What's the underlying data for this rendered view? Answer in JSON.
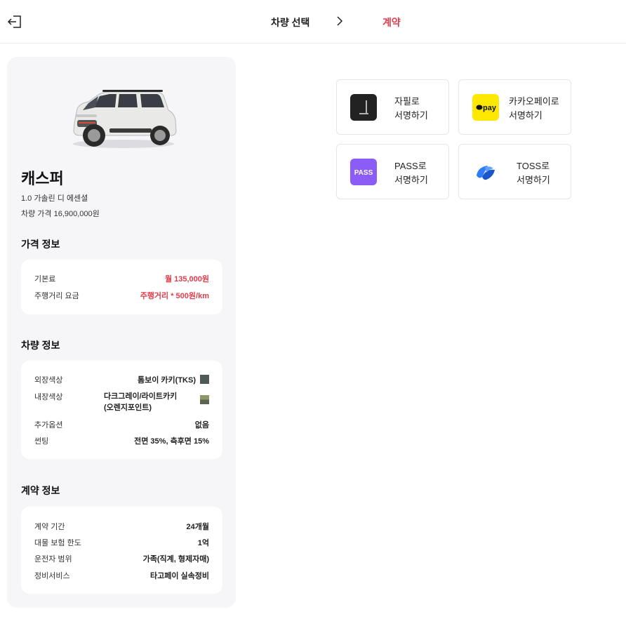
{
  "header": {
    "step1": "차량 선택",
    "step2": "계약"
  },
  "car": {
    "name": "캐스퍼",
    "trim": "1.0 가솔린 디 에센셜",
    "price": "차량 가격 16,900,000원"
  },
  "price_info": {
    "title": "가격 정보",
    "rows": [
      {
        "label": "기본료",
        "value": "월 135,000원"
      },
      {
        "label": "주행거리 요금",
        "value": "주행거리 * 500원/km"
      }
    ]
  },
  "vehicle_info": {
    "title": "차량 정보",
    "exterior_label": "외장색상",
    "exterior_value": "톰보이 카키(TKS)",
    "exterior_color": "#4d5a56",
    "interior_label": "내장색상",
    "interior_value_line1": "다크그레이/라이트카키",
    "interior_value_line2": "(오렌지포인트)",
    "interior_color_top": "#8f9668",
    "interior_color_bottom": "#5d6451",
    "options_label": "추가옵션",
    "options_value": "없음",
    "tint_label": "썬팅",
    "tint_value": "전면 35%, 측후면 15%"
  },
  "contract_info": {
    "title": "계약 정보",
    "rows": [
      {
        "label": "계약 기간",
        "value": "24개월"
      },
      {
        "label": "대물 보험 한도",
        "value": "1억"
      },
      {
        "label": "운전자 범위",
        "value": "가족(직계, 형제자매)"
      },
      {
        "label": "정비서비스",
        "value": "타고페이 실속정비"
      }
    ]
  },
  "sign_options": [
    {
      "line1": "자필로",
      "line2": "서명하기",
      "icon": "pen-icon",
      "color": "#222222"
    },
    {
      "line1": "카카오페이로",
      "line2": "서명하기",
      "icon": "kakaopay-icon",
      "color": "#ffe800",
      "icon_text": "pay"
    },
    {
      "line1": "PASS로",
      "line2": "서명하기",
      "icon": "pass-icon",
      "color": "#8b5cf6",
      "icon_text": "PASS"
    },
    {
      "line1": "TOSS로",
      "line2": "서명하기",
      "icon": "toss-icon",
      "color": "#2f7cf6"
    }
  ],
  "colors": {
    "accent_red": "#e03c4a",
    "panel_bg": "#f6f6f8"
  }
}
